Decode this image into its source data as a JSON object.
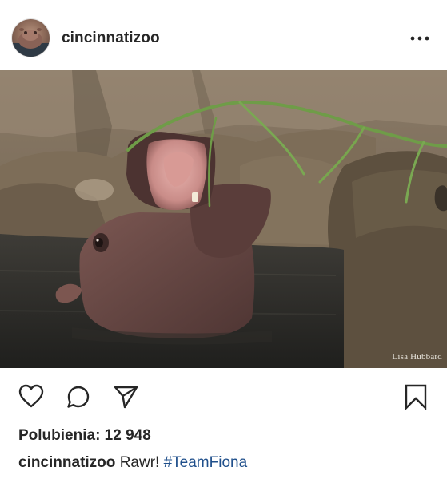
{
  "post": {
    "username": "cincinnatizoo",
    "more_icon": "more-horizontal-icon",
    "photo_credit": "Lisa Hubbard",
    "likes_label": "Polubienia: 12 948",
    "caption": {
      "username": "cincinnatizoo",
      "text": "Rawr!",
      "hashtag": "#TeamFiona"
    }
  },
  "actions": {
    "like_icon": "heart-icon",
    "comment_icon": "comment-icon",
    "share_icon": "send-icon",
    "save_icon": "bookmark-icon"
  },
  "colors": {
    "text": "#262626",
    "hashtag": "#1f4f8b",
    "water": "#2b2a27",
    "hippo": "#6b4a45"
  }
}
